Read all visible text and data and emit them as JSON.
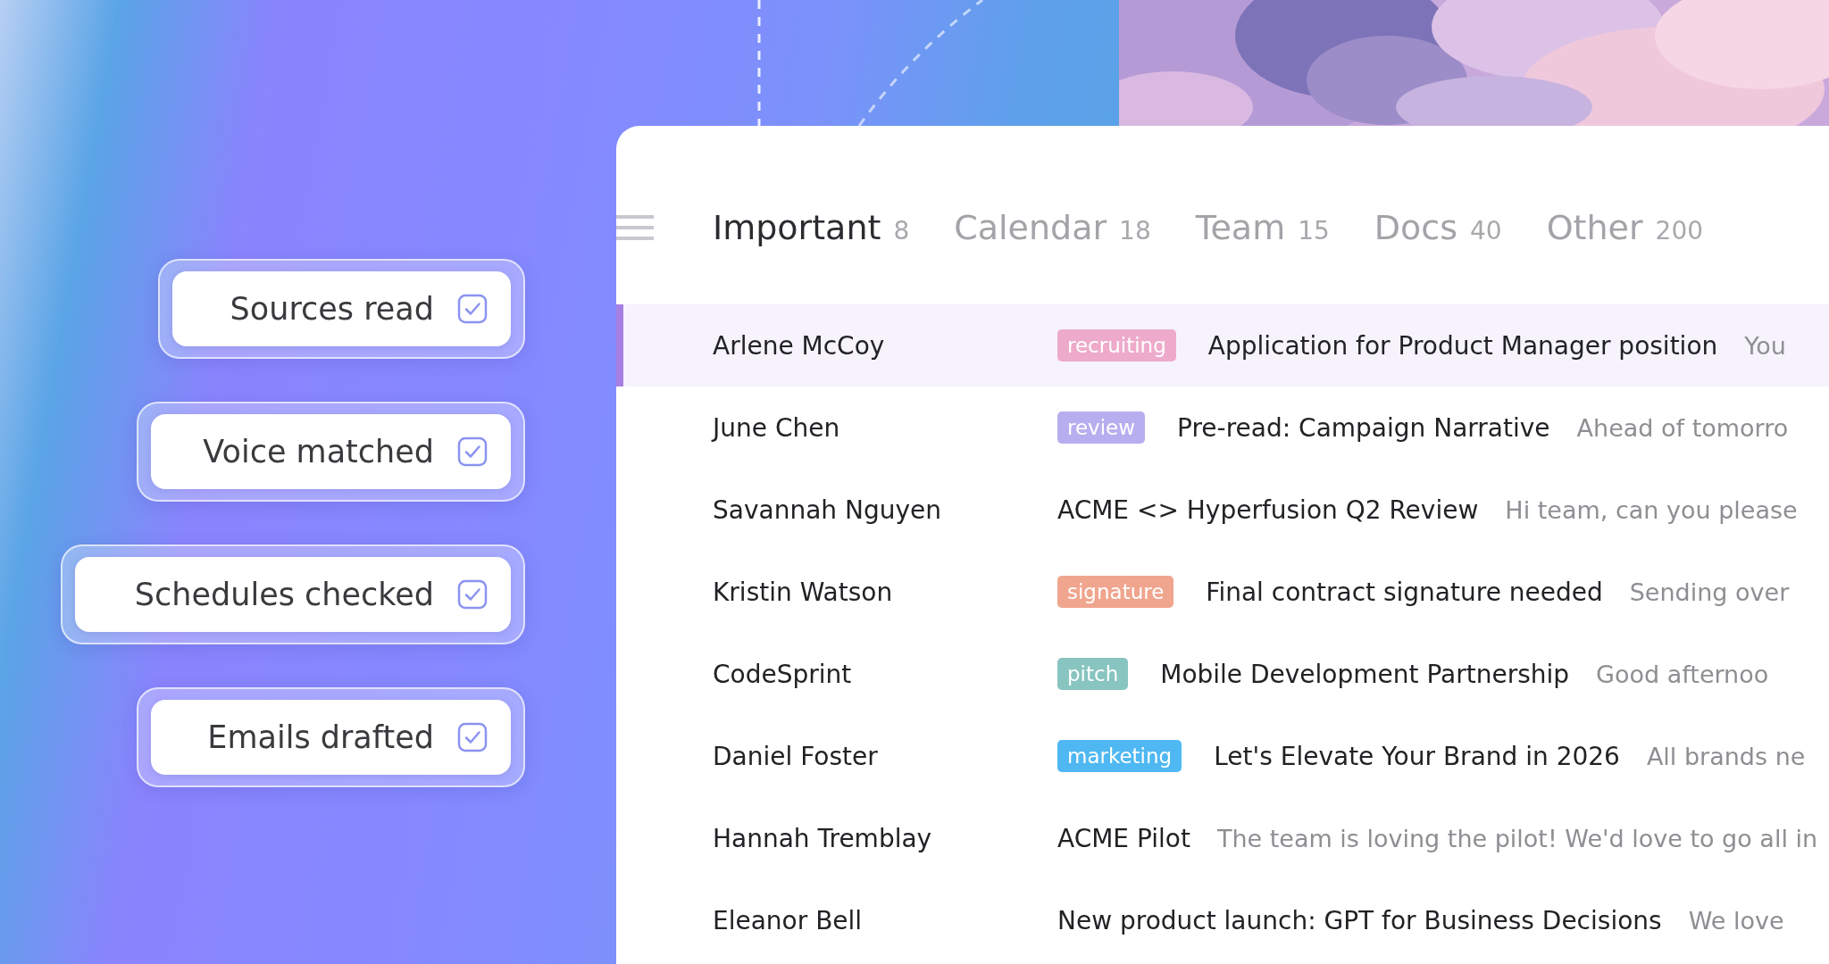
{
  "checklist": [
    {
      "label": "Sources read",
      "checked": true
    },
    {
      "label": "Voice matched",
      "checked": true
    },
    {
      "label": "Schedules checked",
      "checked": true
    },
    {
      "label": "Emails drafted",
      "checked": true
    }
  ],
  "tabs": [
    {
      "label": "Important",
      "count": "8",
      "selected": true
    },
    {
      "label": "Calendar",
      "count": "18",
      "selected": false
    },
    {
      "label": "Team",
      "count": "15",
      "selected": false
    },
    {
      "label": "Docs",
      "count": "40",
      "selected": false
    },
    {
      "label": "Other",
      "count": "200",
      "selected": false
    }
  ],
  "emails": [
    {
      "sender": "Arlene McCoy",
      "tag": {
        "label": "recruiting",
        "color": "#eeaacb"
      },
      "subject": "Application for Product Manager position",
      "preview": "You",
      "selected": true
    },
    {
      "sender": "June Chen",
      "tag": {
        "label": "review",
        "color": "#b7aef0"
      },
      "subject": "Pre-read: Campaign Narrative",
      "preview": "Ahead of tomorro",
      "selected": false
    },
    {
      "sender": "Savannah Nguyen",
      "subject": "ACME <> Hyperfusion Q2 Review",
      "preview": "Hi team, can you please",
      "selected": false
    },
    {
      "sender": "Kristin Watson",
      "tag": {
        "label": "signature",
        "color": "#f0a58e"
      },
      "subject": "Final contract signature needed",
      "preview": "Sending over",
      "selected": false
    },
    {
      "sender": "CodeSprint",
      "tag": {
        "label": "pitch",
        "color": "#88c4c0"
      },
      "subject": "Mobile Development Partnership",
      "preview": "Good afternoo",
      "selected": false
    },
    {
      "sender": "Daniel Foster",
      "tag": {
        "label": "marketing",
        "color": "#4fb8f2"
      },
      "subject": "Let's Elevate Your Brand in 2026",
      "preview": "All brands ne",
      "selected": false
    },
    {
      "sender": "Hannah Tremblay",
      "subject": "ACME Pilot",
      "preview": "The team is loving the pilot! We'd love to go all in",
      "selected": false
    },
    {
      "sender": "Eleanor Bell",
      "subject": "New product launch: GPT for Business Decisions",
      "preview": "We love",
      "selected": false
    }
  ]
}
